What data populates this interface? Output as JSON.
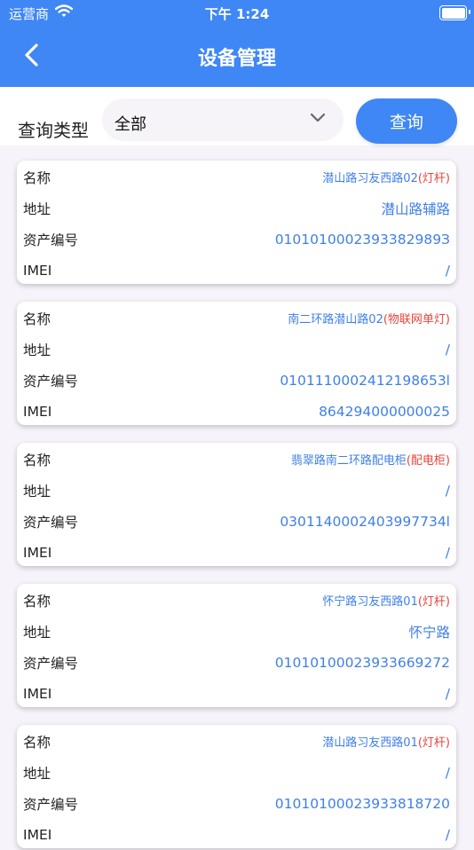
{
  "status_bar": {
    "carrier": "运营商",
    "time": "下午 1:24"
  },
  "header": {
    "title": "设备管理"
  },
  "filter": {
    "label": "查询类型",
    "selected": "全部",
    "button": "查询"
  },
  "field_labels": {
    "name": "名称",
    "address": "地址",
    "asset": "资产编号",
    "imei": "IMEI"
  },
  "colors": {
    "primary": "#3f87f5",
    "value_blue": "#3f7fe8",
    "type_red": "#e8453c"
  },
  "devices": [
    {
      "name": "潜山路习友西路02",
      "type": "(灯杆)",
      "address": "潜山路辅路",
      "asset": "0101010002393382989З",
      "imei": "/"
    },
    {
      "name": "南二环路潜山路02",
      "type": "(物联网单灯)",
      "address": "/",
      "asset": "0101110002412198653l",
      "imei": "864294000000025"
    },
    {
      "name": "翡翠路南二环路配电柜",
      "type": "(配电柜)",
      "address": "/",
      "asset": "0301140002403997734l",
      "imei": "/"
    },
    {
      "name": "怀宁路习友西路01",
      "type": "(灯杆)",
      "address": "怀宁路",
      "asset": "01010100023933669272",
      "imei": "/"
    },
    {
      "name": "潜山路习友西路01",
      "type": "(灯杆)",
      "address": "/",
      "asset": "01010100023933818720",
      "imei": "/"
    }
  ]
}
